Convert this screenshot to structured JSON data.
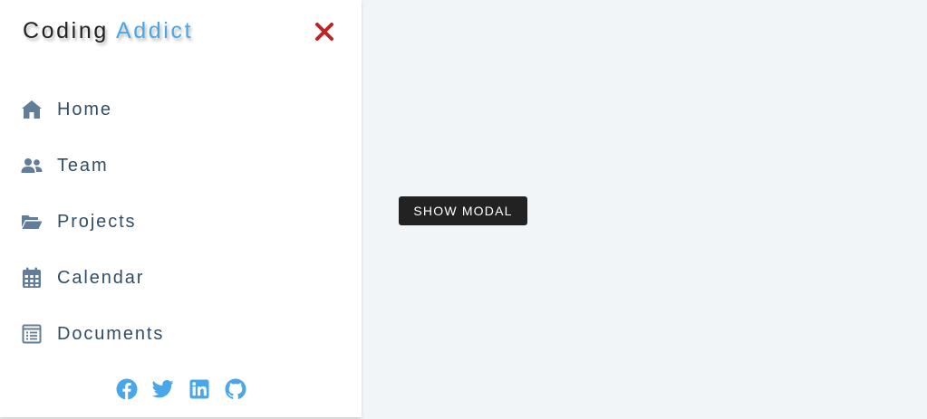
{
  "logo": {
    "part1": "Coding",
    "part2": "Addict"
  },
  "close": {
    "icon": "close-icon",
    "color": "#bb2525"
  },
  "nav": {
    "items": [
      {
        "label": "Home",
        "icon": "home-icon"
      },
      {
        "label": "Team",
        "icon": "users-icon"
      },
      {
        "label": "Projects",
        "icon": "folder-open-icon"
      },
      {
        "label": "Calendar",
        "icon": "calendar-icon"
      },
      {
        "label": "Documents",
        "icon": "document-icon"
      }
    ]
  },
  "socials": [
    {
      "icon": "facebook-icon"
    },
    {
      "icon": "twitter-icon"
    },
    {
      "icon": "linkedin-icon"
    },
    {
      "icon": "github-icon"
    }
  ],
  "main": {
    "show_modal_label": "Show Modal"
  },
  "colors": {
    "accent": "#49a6e9",
    "text": "#324d67",
    "icon": "#617d98",
    "close": "#bb2525",
    "background": "#f1f5f8"
  }
}
